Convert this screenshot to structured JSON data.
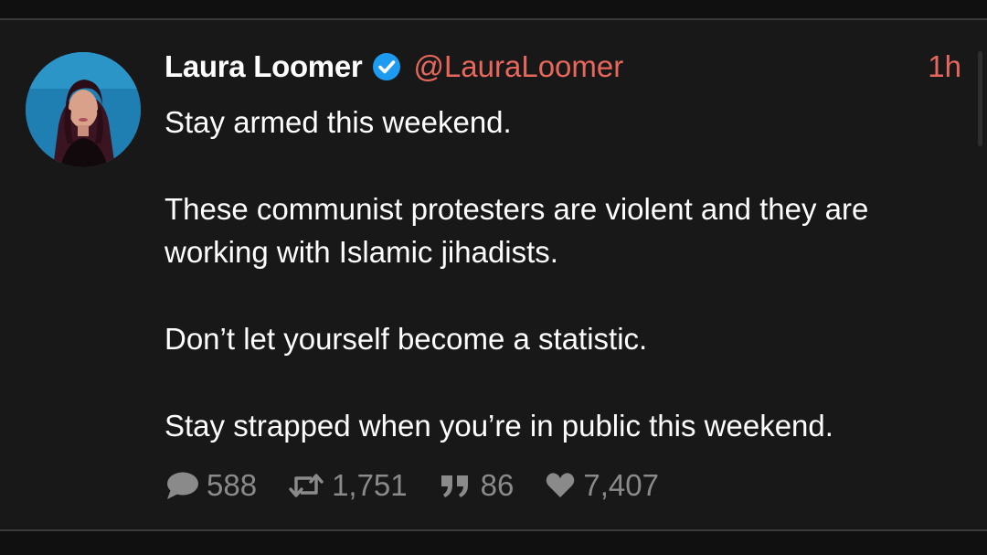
{
  "tweet": {
    "display_name": "Laura Loomer",
    "handle": "@LauraLoomer",
    "time": "1h",
    "verified_icon": "verified-badge-icon",
    "paragraphs": [
      "Stay armed this weekend.",
      "These communist protesters are violent and they are working with Islamic jihadists.",
      "Don’t let yourself become a statistic.",
      "Stay strapped when you’re in public this weekend."
    ]
  },
  "actions": {
    "replies": {
      "icon": "speech-bubble-icon",
      "count": "588"
    },
    "retweets": {
      "icon": "retweet-icon",
      "count": "1,751"
    },
    "quotes": {
      "icon": "quote-icon",
      "count": "86"
    },
    "likes": {
      "icon": "heart-icon",
      "count": "7,407"
    }
  },
  "colors": {
    "background": "#181818",
    "text": "#ffffff",
    "accent": "#e8675c",
    "muted": "#8a8a8a",
    "verified": "#1d9bf0"
  }
}
